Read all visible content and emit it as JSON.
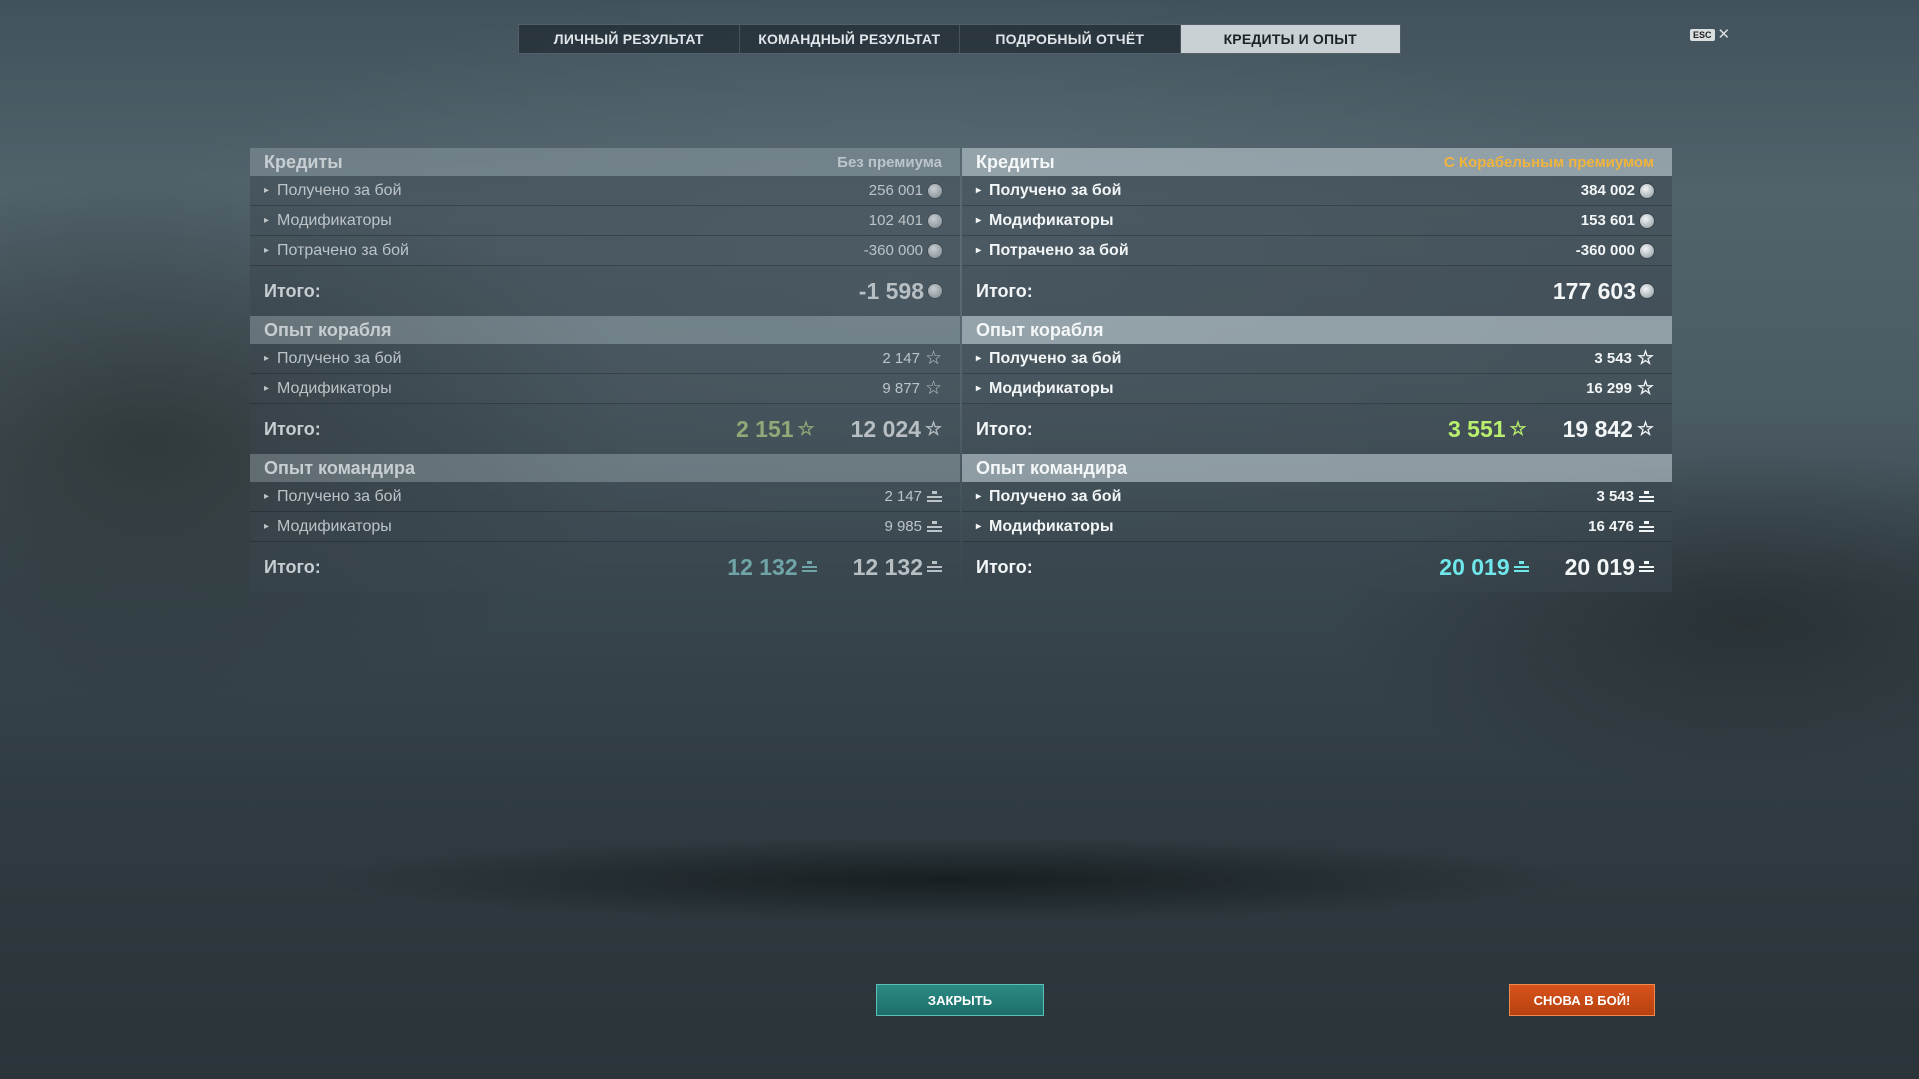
{
  "tabs": [
    {
      "label": "ЛИЧНЫЙ РЕЗУЛЬТАТ",
      "active": false
    },
    {
      "label": "КОМАНДНЫЙ РЕЗУЛЬТАТ",
      "active": false
    },
    {
      "label": "ПОДРОБНЫЙ ОТЧЁТ",
      "active": false
    },
    {
      "label": "КРЕДИТЫ И ОПЫТ",
      "active": true
    }
  ],
  "esc": {
    "key": "ESC",
    "close": "✕"
  },
  "left": {
    "credits": {
      "title": "Кредиты",
      "note": "Без премиума",
      "rows": [
        {
          "label": "Получено за бой",
          "value": "256 001"
        },
        {
          "label": "Модификаторы",
          "value": "102 401"
        },
        {
          "label": "Потрачено за бой",
          "value": "-360 000"
        }
      ],
      "total_label": "Итого:",
      "total": "-1 598"
    },
    "ship_xp": {
      "title": "Опыт корабля",
      "rows": [
        {
          "label": "Получено за бой",
          "value": "2 147"
        },
        {
          "label": "Модификаторы",
          "value": "9 877"
        }
      ],
      "total_label": "Итого:",
      "total_free": "2 151",
      "total": "12 024"
    },
    "cmdr_xp": {
      "title": "Опыт командира",
      "rows": [
        {
          "label": "Получено за бой",
          "value": "2 147"
        },
        {
          "label": "Модификаторы",
          "value": "9 985"
        }
      ],
      "total_label": "Итого:",
      "total_free": "12 132",
      "total": "12 132"
    }
  },
  "right": {
    "credits": {
      "title": "Кредиты",
      "note": "С Корабельным премиумом",
      "rows": [
        {
          "label": "Получено за бой",
          "value": "384 002"
        },
        {
          "label": "Модификаторы",
          "value": "153 601"
        },
        {
          "label": "Потрачено за бой",
          "value": "-360 000"
        }
      ],
      "total_label": "Итого:",
      "total": "177 603"
    },
    "ship_xp": {
      "title": "Опыт корабля",
      "rows": [
        {
          "label": "Получено за бой",
          "value": "3 543"
        },
        {
          "label": "Модификаторы",
          "value": "16 299"
        }
      ],
      "total_label": "Итого:",
      "total_free": "3 551",
      "total": "19 842"
    },
    "cmdr_xp": {
      "title": "Опыт командира",
      "rows": [
        {
          "label": "Получено за бой",
          "value": "3 543"
        },
        {
          "label": "Модификаторы",
          "value": "16 476"
        }
      ],
      "total_label": "Итого:",
      "total_free": "20 019",
      "total": "20 019"
    }
  },
  "icons": {
    "arrow": "▸",
    "star": "☆"
  },
  "buttons": {
    "close": "ЗАКРЫТЬ",
    "battle": "СНОВА В БОЙ!"
  }
}
